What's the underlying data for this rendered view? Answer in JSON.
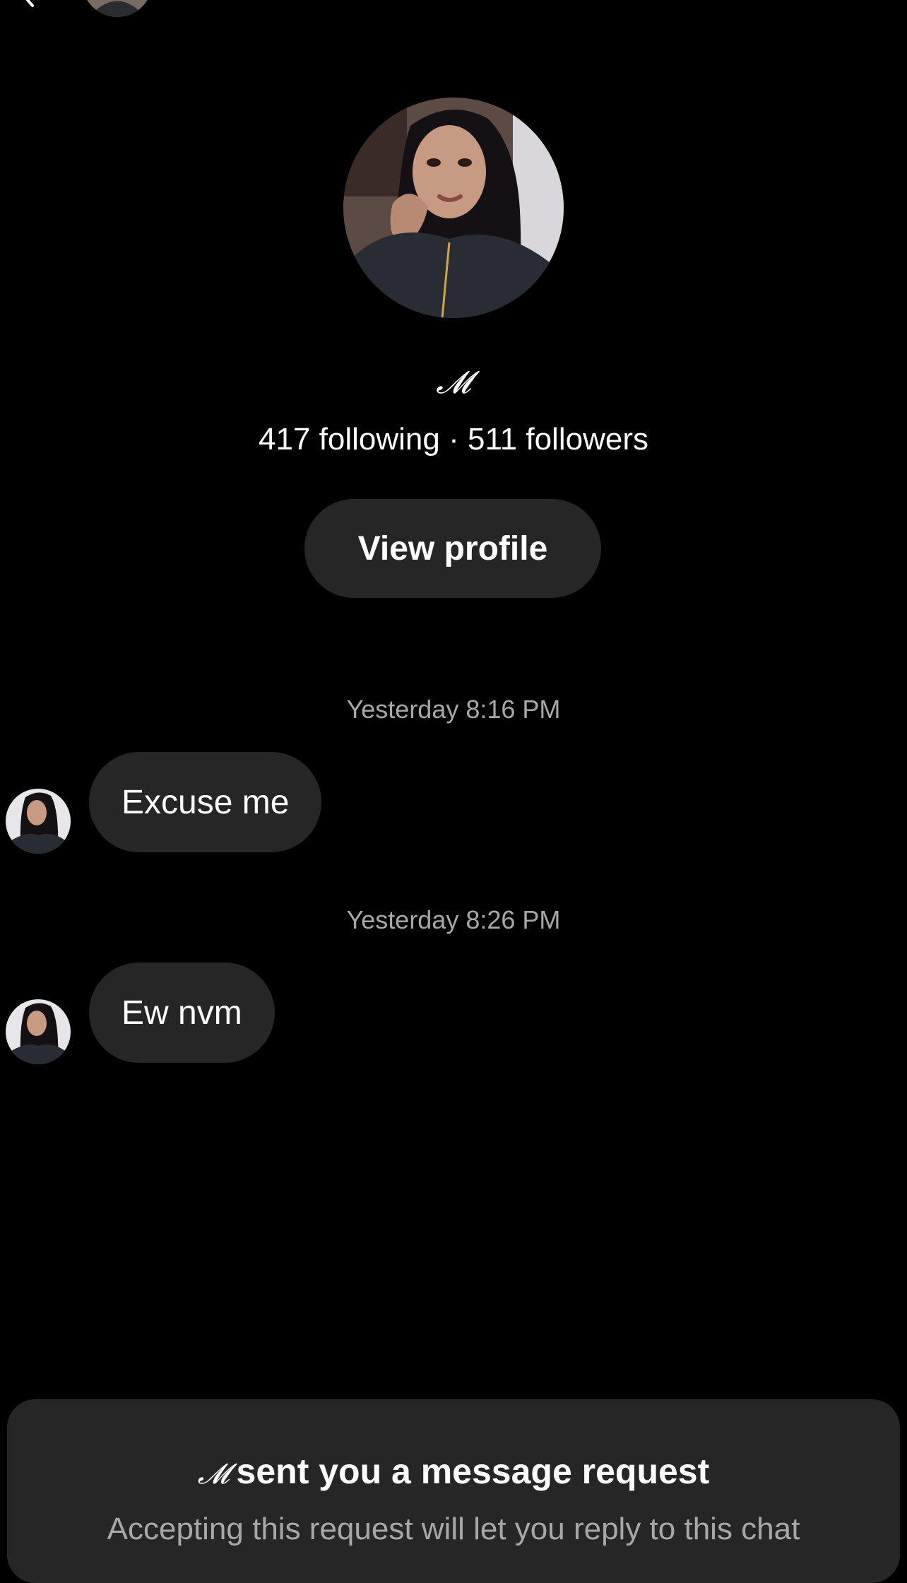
{
  "header": {
    "back_icon": "chevron-left-icon",
    "avatar": "profile-photo"
  },
  "profile": {
    "name": "𝓜",
    "stats": "417 following · 511 followers",
    "view_profile_label": "View profile"
  },
  "messages": [
    {
      "timestamp": "Yesterday 8:16 PM",
      "text": "Excuse me"
    },
    {
      "timestamp": "Yesterday 8:26 PM",
      "text": "Ew nvm"
    }
  ],
  "request": {
    "name": "𝓜",
    "title": "sent you a message request",
    "subtitle": "Accepting this request will let you reply to this chat"
  },
  "colors": {
    "background": "#000000",
    "bubble": "#262626",
    "secondary_text": "#a8a8a8"
  }
}
